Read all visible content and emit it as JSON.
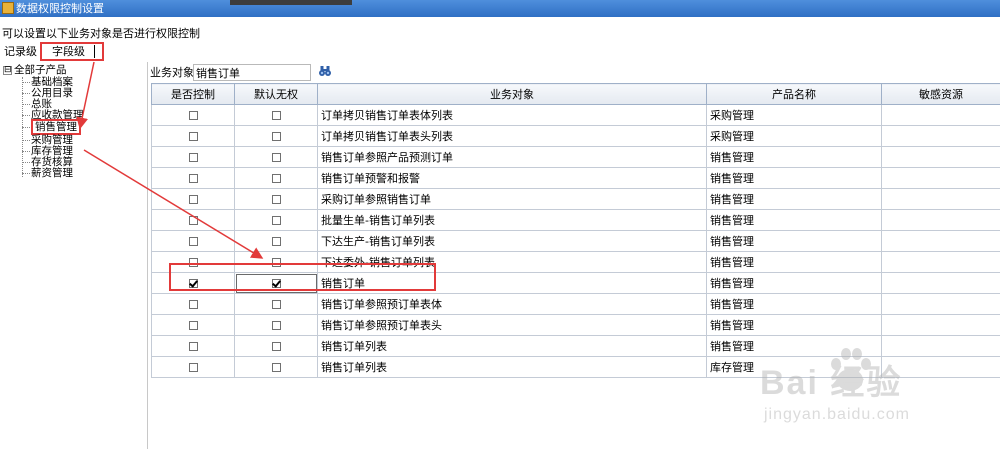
{
  "window": {
    "title": "数据权限控制设置"
  },
  "hint": "可以设置以下业务对象是否进行权限控制",
  "tabs": {
    "record": "记录级",
    "field": "字段级"
  },
  "tree": {
    "root": "全部子产品",
    "root_toggle": "⊟",
    "items": [
      "基础档案",
      "公用目录",
      "总账",
      "应收款管理",
      "销售管理",
      "采购管理",
      "库存管理",
      "存货核算",
      "薪资管理"
    ]
  },
  "search": {
    "label": "业务对象",
    "value": "销售订单",
    "icon": "binoculars-icon"
  },
  "grid": {
    "headers": [
      "是否控制",
      "默认无权",
      "业务对象",
      "产品名称",
      "敏感资源"
    ],
    "rows": [
      {
        "ctrl": false,
        "deny": false,
        "object": "订单拷贝销售订单表体列表",
        "product": "采购管理",
        "sensitive": ""
      },
      {
        "ctrl": false,
        "deny": false,
        "object": "订单拷贝销售订单表头列表",
        "product": "采购管理",
        "sensitive": ""
      },
      {
        "ctrl": false,
        "deny": false,
        "object": "销售订单参照产品预测订单",
        "product": "销售管理",
        "sensitive": ""
      },
      {
        "ctrl": false,
        "deny": false,
        "object": "销售订单预警和报警",
        "product": "销售管理",
        "sensitive": ""
      },
      {
        "ctrl": false,
        "deny": false,
        "object": "采购订单参照销售订单",
        "product": "销售管理",
        "sensitive": ""
      },
      {
        "ctrl": false,
        "deny": false,
        "object": "批量生单-销售订单列表",
        "product": "销售管理",
        "sensitive": ""
      },
      {
        "ctrl": false,
        "deny": false,
        "object": "下达生产-销售订单列表",
        "product": "销售管理",
        "sensitive": ""
      },
      {
        "ctrl": false,
        "deny": false,
        "object": "下达委外-销售订单列表",
        "product": "销售管理",
        "sensitive": ""
      },
      {
        "ctrl": true,
        "deny": true,
        "object": "销售订单",
        "product": "销售管理",
        "sensitive": ""
      },
      {
        "ctrl": false,
        "deny": false,
        "object": "销售订单参照预订单表体",
        "product": "销售管理",
        "sensitive": ""
      },
      {
        "ctrl": false,
        "deny": false,
        "object": "销售订单参照预订单表头",
        "product": "销售管理",
        "sensitive": ""
      },
      {
        "ctrl": false,
        "deny": false,
        "object": "销售订单列表",
        "product": "销售管理",
        "sensitive": ""
      },
      {
        "ctrl": false,
        "deny": false,
        "object": "销售订单列表",
        "product": "库存管理",
        "sensitive": ""
      }
    ]
  },
  "watermark": {
    "main": "Bai 经验",
    "sub": "jingyan.baidu.com"
  },
  "colors": {
    "annotation": "#e23a3a",
    "titlebar": "#3a7bd0"
  }
}
